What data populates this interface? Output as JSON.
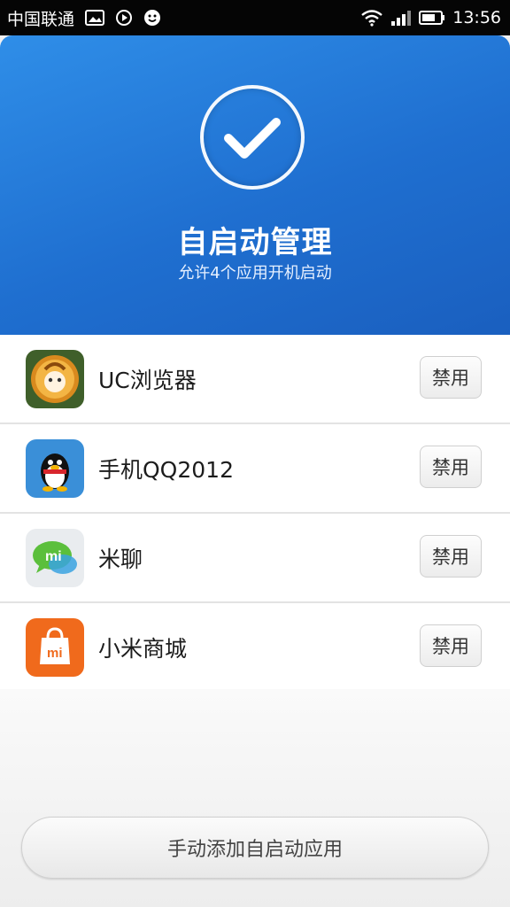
{
  "status_bar": {
    "carrier": "中国联通",
    "time": "13:56",
    "icons": [
      "image-icon",
      "play-icon",
      "smiley-icon",
      "wifi-icon",
      "signal-icon",
      "battery-icon"
    ]
  },
  "header": {
    "title": "自启动管理",
    "subtitle": "允许4个应用开机启动",
    "colors": {
      "top": "#2f8ee8",
      "bottom": "#1a5fbf"
    }
  },
  "apps": [
    {
      "name": "UC浏览器",
      "icon": "uc-browser-icon",
      "button": "禁用"
    },
    {
      "name": "手机QQ2012",
      "icon": "qq-penguin-icon",
      "button": "禁用"
    },
    {
      "name": "米聊",
      "icon": "miliao-icon",
      "button": "禁用"
    },
    {
      "name": "小米商城",
      "icon": "mi-store-icon",
      "button": "禁用"
    }
  ],
  "footer": {
    "add_button": "手动添加自启动应用"
  }
}
